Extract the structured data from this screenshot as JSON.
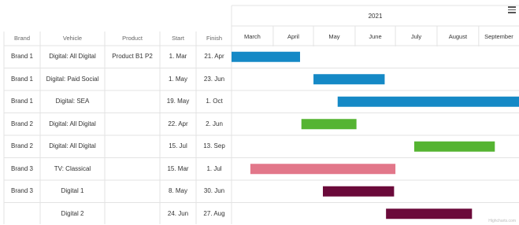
{
  "columns": {
    "brand": "Brand",
    "vehicle": "Vehicle",
    "product": "Product",
    "start": "Start",
    "finish": "Finish"
  },
  "rows": [
    {
      "brand": "Brand 1",
      "vehicle": "Digital: All Digital",
      "product": "Product B1 P2",
      "start": "1. Mar",
      "finish": "21. Apr"
    },
    {
      "brand": "Brand 1",
      "vehicle": "Digital: Paid Social",
      "product": "",
      "start": "1. May",
      "finish": "23. Jun"
    },
    {
      "brand": "Brand 1",
      "vehicle": "Digital: SEA",
      "product": "",
      "start": "19. May",
      "finish": "1. Oct"
    },
    {
      "brand": "Brand 2",
      "vehicle": "Digital: All Digital",
      "product": "",
      "start": "22. Apr",
      "finish": "2. Jun"
    },
    {
      "brand": "Brand 2",
      "vehicle": "Digital: All Digital",
      "product": "",
      "start": "15. Jul",
      "finish": "13. Sep"
    },
    {
      "brand": "Brand 3",
      "vehicle": "TV: Classical",
      "product": "",
      "start": "15. Mar",
      "finish": "1. Jul"
    },
    {
      "brand": "Brand 3",
      "vehicle": "Digital 1",
      "product": "",
      "start": "8. May",
      "finish": "30. Jun"
    },
    {
      "brand": "",
      "vehicle": "Digital 2",
      "product": "",
      "start": "24. Jun",
      "finish": "27. Aug"
    }
  ],
  "chart_data": {
    "type": "gantt",
    "year_label": "2021",
    "months": [
      "March",
      "April",
      "May",
      "June",
      "July",
      "August",
      "September"
    ],
    "x_range": [
      "2021-03-01",
      "2021-09-30"
    ],
    "tasks": [
      {
        "start": "2021-03-01",
        "end": "2021-04-21",
        "color": "#1589c6"
      },
      {
        "start": "2021-05-01",
        "end": "2021-06-23",
        "color": "#1589c6"
      },
      {
        "start": "2021-05-19",
        "end": "2021-10-01",
        "color": "#1589c6"
      },
      {
        "start": "2021-04-22",
        "end": "2021-06-02",
        "color": "#55b432"
      },
      {
        "start": "2021-07-15",
        "end": "2021-09-13",
        "color": "#55b432"
      },
      {
        "start": "2021-03-15",
        "end": "2021-07-01",
        "color": "#e2778a"
      },
      {
        "start": "2021-05-08",
        "end": "2021-06-30",
        "color": "#6b0a3a"
      },
      {
        "start": "2021-06-24",
        "end": "2021-08-27",
        "color": "#6b0a3a"
      }
    ]
  },
  "credit": "Highcharts.com"
}
